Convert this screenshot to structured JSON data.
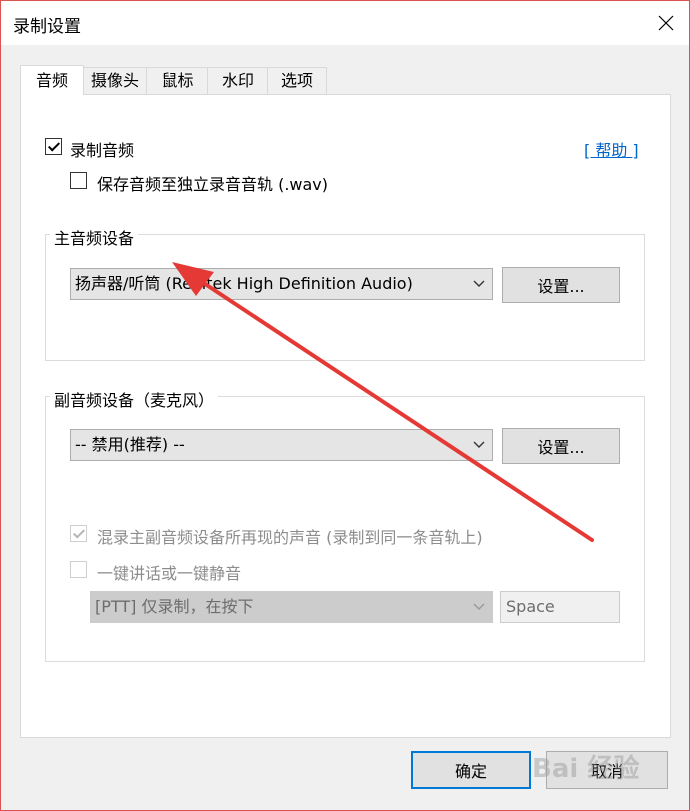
{
  "window": {
    "title": "录制设置"
  },
  "tabs": [
    {
      "label": "音频"
    },
    {
      "label": "摄像头"
    },
    {
      "label": "鼠标"
    },
    {
      "label": "水印"
    },
    {
      "label": "选项"
    }
  ],
  "record_audio": {
    "label": "录制音频",
    "checked": true
  },
  "help_link": {
    "label": "[ 帮助 ]"
  },
  "save_wav": {
    "label": "保存音频至独立录音音轨 (.wav)",
    "checked": false
  },
  "main_device": {
    "title": "主音频设备",
    "selected": "扬声器/听筒 (Realtek High Definition Audio)",
    "settings_label": "设置..."
  },
  "secondary_device": {
    "title": "副音频设备（麦克风）",
    "selected": "-- 禁用(推荐) --",
    "settings_label": "设置..."
  },
  "mix_option": {
    "label": "混录主副音频设备所再现的声音 (录制到同一条音轨上)",
    "checked": true,
    "disabled": true
  },
  "ptt_option": {
    "label": "一键讲话或一键静音",
    "checked": false,
    "disabled": true
  },
  "ptt_mode": {
    "selected": "[PTT] 仅录制，在按下"
  },
  "ptt_key": {
    "value": "Space"
  },
  "footer": {
    "ok_label": "确定",
    "cancel_label": "取消"
  },
  "annotation": {
    "arrow_color": "#e53935"
  },
  "watermark": {
    "text": "Bai 经验"
  }
}
